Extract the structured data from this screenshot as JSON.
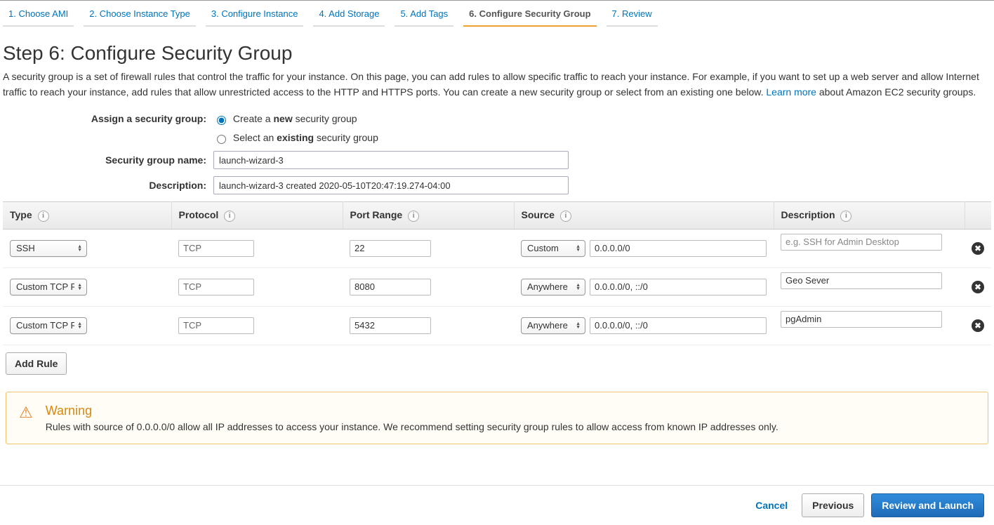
{
  "tabs": [
    {
      "label": "1. Choose AMI",
      "active": false
    },
    {
      "label": "2. Choose Instance Type",
      "active": false
    },
    {
      "label": "3. Configure Instance",
      "active": false
    },
    {
      "label": "4. Add Storage",
      "active": false
    },
    {
      "label": "5. Add Tags",
      "active": false
    },
    {
      "label": "6. Configure Security Group",
      "active": true
    },
    {
      "label": "7. Review",
      "active": false
    }
  ],
  "page_title": "Step 6: Configure Security Group",
  "page_description_pre": "A security group is a set of firewall rules that control the traffic for your instance. On this page, you can add rules to allow specific traffic to reach your instance. For example, if you want to set up a web server and allow Internet traffic to reach your instance, add rules that allow unrestricted access to the HTTP and HTTPS ports. You can create a new security group or select from an existing one below. ",
  "learn_more_label": "Learn more",
  "page_description_post": " about Amazon EC2 security groups.",
  "assign_label": "Assign a security group:",
  "radio_create_pre": "Create a ",
  "radio_create_bold": "new",
  "radio_create_post": " security group",
  "radio_select_pre": "Select an ",
  "radio_select_bold": "existing",
  "radio_select_post": " security group",
  "sg_name_label": "Security group name:",
  "sg_name_value": "launch-wizard-3",
  "sg_desc_label": "Description:",
  "sg_desc_value": "launch-wizard-3 created 2020-05-10T20:47:19.274-04:00",
  "columns": {
    "type": "Type",
    "protocol": "Protocol",
    "port": "Port Range",
    "source": "Source",
    "description": "Description"
  },
  "rules": [
    {
      "type": "SSH",
      "protocol": "TCP",
      "port": "22",
      "source_mode": "Custom",
      "cidr": "0.0.0.0/0",
      "desc": "",
      "desc_placeholder": "e.g. SSH for Admin Desktop"
    },
    {
      "type": "Custom TCP Rule",
      "protocol": "TCP",
      "port": "8080",
      "source_mode": "Anywhere",
      "cidr": "0.0.0.0/0, ::/0",
      "desc": "Geo Sever",
      "desc_placeholder": ""
    },
    {
      "type": "Custom TCP Rule",
      "protocol": "TCP",
      "port": "5432",
      "source_mode": "Anywhere",
      "cidr": "0.0.0.0/0, ::/0",
      "desc": "pgAdmin",
      "desc_placeholder": ""
    }
  ],
  "add_rule_label": "Add Rule",
  "warning": {
    "title": "Warning",
    "text": "Rules with source of 0.0.0.0/0 allow all IP addresses to access your instance. We recommend setting security group rules to allow access from known IP addresses only."
  },
  "footer": {
    "cancel": "Cancel",
    "previous": "Previous",
    "review": "Review and Launch"
  }
}
